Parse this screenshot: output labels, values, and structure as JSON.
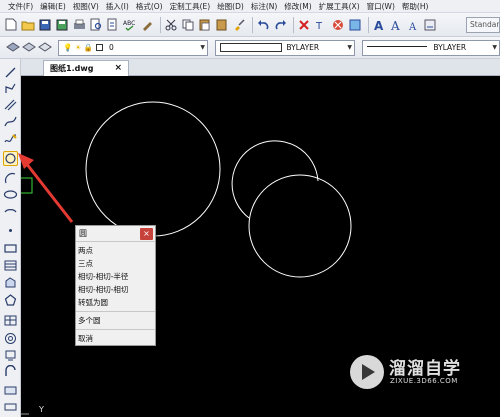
{
  "menu": [
    "文件(F)",
    "编辑(E)",
    "视图(V)",
    "插入(I)",
    "格式(O)",
    "定制工具(E)",
    "绘图(D)",
    "标注(N)",
    "修改(M)",
    "扩展工具(X)",
    "窗口(W)",
    "帮助(H)"
  ],
  "toolbar": {
    "text_style_box": "Standar",
    "layer_value": "0",
    "color_value": "BYLAYER",
    "linetype_value": "BYLAYER"
  },
  "document_tab": {
    "label": "图纸1.dwg",
    "close": "×"
  },
  "popup": {
    "title": "圆",
    "close": "×",
    "items": [
      "两点",
      "三点",
      "相切-相切-半径",
      "相切-相切-相切",
      "转弧为圆"
    ],
    "more": "多个圆",
    "cancel": "取消"
  },
  "ucs_label": "Y",
  "watermark": {
    "title": "溜溜自学",
    "url": "ZIXUE.3D66.COM"
  },
  "colors": {
    "canvas": "#000000",
    "entity": "#ffffff",
    "arrow": "#e53a32",
    "close_button": "#c8423c"
  }
}
